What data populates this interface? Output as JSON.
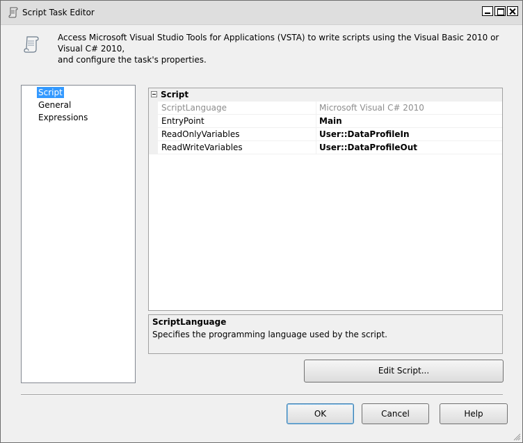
{
  "window": {
    "title": "Script Task Editor",
    "icon": "script-scroll-icon"
  },
  "header": {
    "icon": "script-scroll-icon",
    "description_line1": "Access Microsoft Visual Studio Tools for Applications (VSTA) to write scripts using the Visual Basic 2010 or Visual C# 2010,",
    "description_line2": "and configure the task's properties."
  },
  "nav": {
    "items": [
      {
        "label": "Script",
        "selected": true
      },
      {
        "label": "General",
        "selected": false
      },
      {
        "label": "Expressions",
        "selected": false
      }
    ]
  },
  "property_grid": {
    "category": "Script",
    "rows": [
      {
        "name": "ScriptLanguage",
        "value": "Microsoft Visual C# 2010",
        "enabled": false,
        "bold": false
      },
      {
        "name": "EntryPoint",
        "value": "Main",
        "enabled": true,
        "bold": true
      },
      {
        "name": "ReadOnlyVariables",
        "value": "User::DataProfileIn",
        "enabled": true,
        "bold": true
      },
      {
        "name": "ReadWriteVariables",
        "value": "User::DataProfileOut",
        "enabled": true,
        "bold": true
      }
    ]
  },
  "description_pane": {
    "title": "ScriptLanguage",
    "text": "Specifies the programming language used by the script."
  },
  "buttons": {
    "edit_script": "Edit Script...",
    "ok": "OK",
    "cancel": "Cancel",
    "help": "Help"
  },
  "colors": {
    "selection": "#3399ff",
    "disabled_text": "#8d8d8d",
    "dialog_bg": "#f0f0f0"
  }
}
